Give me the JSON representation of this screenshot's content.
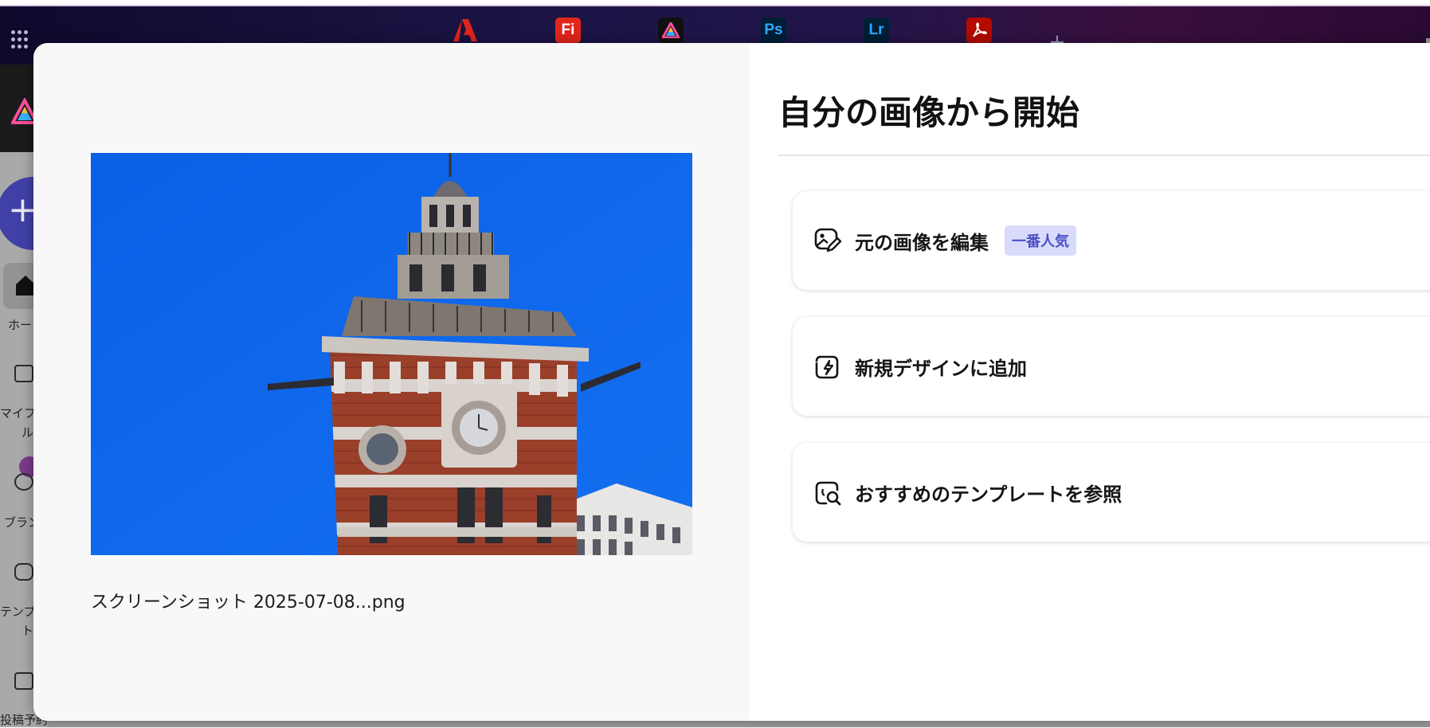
{
  "app_switcher": {
    "apps": [
      {
        "icon": "adobe-logo-icon",
        "label": "",
        "color": "#e1251b",
        "bg": "transparent"
      },
      {
        "icon": "fresco-icon",
        "label": "Fi",
        "color": "#ffffff",
        "bg": "#e1251b"
      },
      {
        "icon": "express-icon",
        "label": "",
        "color": "#ffffff",
        "bg": "#111111"
      },
      {
        "icon": "photoshop-icon",
        "label": "Ps",
        "color": "#31a8ff",
        "bg": "#001e36"
      },
      {
        "icon": "lightroom-icon",
        "label": "Lr",
        "color": "#31a8ff",
        "bg": "#001e36"
      },
      {
        "icon": "acrobat-icon",
        "label": "",
        "color": "#ffffff",
        "bg": "#b30b00"
      }
    ],
    "add_tab_label": "+"
  },
  "sidebar": {
    "create_label": "+",
    "items": [
      {
        "label": "ホー",
        "icon": "home-icon"
      },
      {
        "label": "マイフ",
        "label2": "ル",
        "icon": "folder-icon"
      },
      {
        "label": "ブラン",
        "icon": "brand-icon"
      },
      {
        "label": "テンプ",
        "label2": "ト",
        "icon": "template-icon"
      },
      {
        "label": "投稿予約",
        "icon": "calendar-icon"
      }
    ]
  },
  "modal": {
    "file_name": "スクリーンショット 2025-07-08...png",
    "title": "自分の画像から開始",
    "options": [
      {
        "label": "元の画像を編集",
        "badge": "一番人気",
        "icon": "edit-image-icon"
      },
      {
        "label": "新規デザインに追加",
        "icon": "new-design-icon"
      },
      {
        "label": "おすすめのテンプレートを参照",
        "icon": "browse-templates-icon"
      }
    ]
  },
  "colors": {
    "accent": "#4b4fc6",
    "badge_bg": "#d8dbfb",
    "sky": "#0a63e8"
  }
}
